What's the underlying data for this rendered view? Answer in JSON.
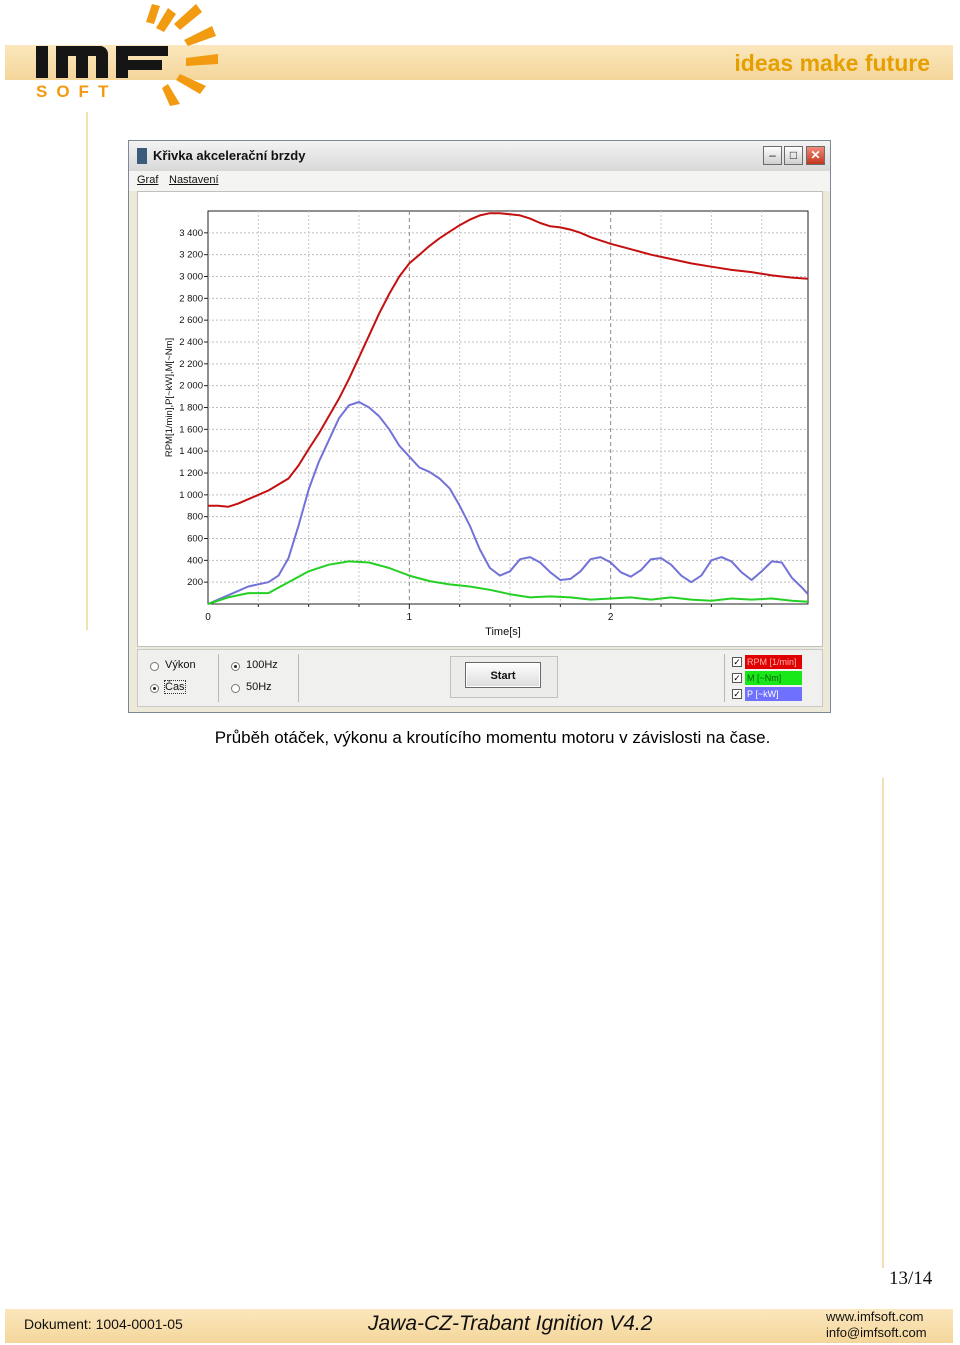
{
  "header": {
    "tagline": "ideas make future",
    "logo_text": "IMF SOFT"
  },
  "window": {
    "title": "Křivka akcelerační brzdy",
    "menu": [
      "Graf",
      "Nastavení"
    ],
    "controls": {
      "mode_options": [
        "Výkon",
        "Čas"
      ],
      "mode_selected": "Čas",
      "freq_options": [
        "100Hz",
        "50Hz"
      ],
      "freq_selected": "100Hz",
      "start_label": "Start"
    },
    "legend": [
      {
        "label": "RPM [1/min]",
        "color": "#e00000",
        "checked": true
      },
      {
        "label": "M [~Nm]",
        "color": "#18e818",
        "checked": true
      },
      {
        "label": "P [~kW]",
        "color": "#7070ff",
        "checked": true
      }
    ]
  },
  "chart_data": {
    "type": "line",
    "xlabel": "Time[s]",
    "ylabel": "RPM[1/min],P[~kW],M[~Nm]",
    "xlim": [
      0,
      2.98
    ],
    "ylim": [
      0,
      3600
    ],
    "x_ticks": [
      "0",
      "1",
      "2"
    ],
    "y_ticks": [
      "200",
      "400",
      "600",
      "800",
      "1 000",
      "1 200",
      "1 400",
      "1 600",
      "1 800",
      "2 000",
      "2 200",
      "2 400",
      "2 600",
      "2 800",
      "3 000",
      "3 200",
      "3 400"
    ],
    "grid": true,
    "series": [
      {
        "name": "RPM [1/min]",
        "color": "#c41010",
        "x": [
          0,
          0.05,
          0.1,
          0.15,
          0.2,
          0.3,
          0.4,
          0.45,
          0.5,
          0.55,
          0.6,
          0.65,
          0.7,
          0.75,
          0.8,
          0.85,
          0.9,
          0.95,
          1.0,
          1.05,
          1.1,
          1.15,
          1.2,
          1.25,
          1.3,
          1.35,
          1.4,
          1.45,
          1.5,
          1.55,
          1.6,
          1.65,
          1.7,
          1.75,
          1.8,
          1.85,
          1.9,
          2.0,
          2.1,
          2.2,
          2.3,
          2.4,
          2.5,
          2.6,
          2.7,
          2.8,
          2.9,
          2.98
        ],
        "y": [
          900,
          900,
          890,
          920,
          960,
          1040,
          1150,
          1270,
          1420,
          1560,
          1720,
          1880,
          2060,
          2260,
          2460,
          2660,
          2840,
          3000,
          3120,
          3200,
          3280,
          3350,
          3410,
          3470,
          3520,
          3560,
          3580,
          3580,
          3570,
          3560,
          3530,
          3490,
          3460,
          3450,
          3430,
          3400,
          3360,
          3300,
          3250,
          3200,
          3160,
          3120,
          3090,
          3060,
          3040,
          3010,
          2990,
          2980
        ]
      },
      {
        "name": "P [~kW]",
        "color": "#7272d8",
        "x": [
          0,
          0.1,
          0.2,
          0.3,
          0.35,
          0.4,
          0.45,
          0.5,
          0.55,
          0.6,
          0.65,
          0.7,
          0.75,
          0.8,
          0.85,
          0.9,
          0.95,
          1.0,
          1.05,
          1.1,
          1.15,
          1.2,
          1.25,
          1.3,
          1.35,
          1.4,
          1.45,
          1.5,
          1.55,
          1.6,
          1.65,
          1.7,
          1.75,
          1.8,
          1.85,
          1.9,
          1.95,
          2.0,
          2.05,
          2.1,
          2.15,
          2.2,
          2.25,
          2.3,
          2.35,
          2.4,
          2.45,
          2.5,
          2.55,
          2.6,
          2.65,
          2.7,
          2.75,
          2.8,
          2.85,
          2.9,
          2.95,
          2.98
        ],
        "y": [
          0,
          80,
          160,
          200,
          260,
          420,
          720,
          1050,
          1300,
          1500,
          1700,
          1820,
          1850,
          1800,
          1720,
          1600,
          1450,
          1350,
          1250,
          1210,
          1150,
          1060,
          900,
          720,
          500,
          330,
          260,
          300,
          410,
          430,
          380,
          290,
          220,
          230,
          300,
          410,
          430,
          380,
          290,
          250,
          310,
          410,
          420,
          360,
          260,
          200,
          260,
          400,
          430,
          390,
          290,
          220,
          300,
          390,
          380,
          240,
          150,
          90
        ]
      },
      {
        "name": "M [~Nm]",
        "color": "#24d024",
        "x": [
          0,
          0.1,
          0.2,
          0.3,
          0.4,
          0.5,
          0.6,
          0.7,
          0.8,
          0.9,
          1.0,
          1.1,
          1.2,
          1.3,
          1.4,
          1.5,
          1.6,
          1.7,
          1.8,
          1.9,
          2.0,
          2.1,
          2.2,
          2.3,
          2.4,
          2.5,
          2.6,
          2.7,
          2.8,
          2.9,
          2.98
        ],
        "y": [
          0,
          60,
          100,
          100,
          200,
          300,
          360,
          390,
          380,
          330,
          260,
          210,
          180,
          160,
          130,
          90,
          60,
          70,
          60,
          40,
          50,
          60,
          40,
          60,
          40,
          30,
          50,
          40,
          50,
          30,
          20
        ]
      }
    ]
  },
  "caption": "Průběh otáček, výkonu a kroutícího momentu motoru v závislosti na čase.",
  "footer": {
    "page": "13/14",
    "document": "Dokument: 1004-0001-05",
    "product": "Jawa-CZ-Trabant Ignition V4.2",
    "web": "www.imfsoft.com",
    "email": "info@imfsoft.com"
  }
}
